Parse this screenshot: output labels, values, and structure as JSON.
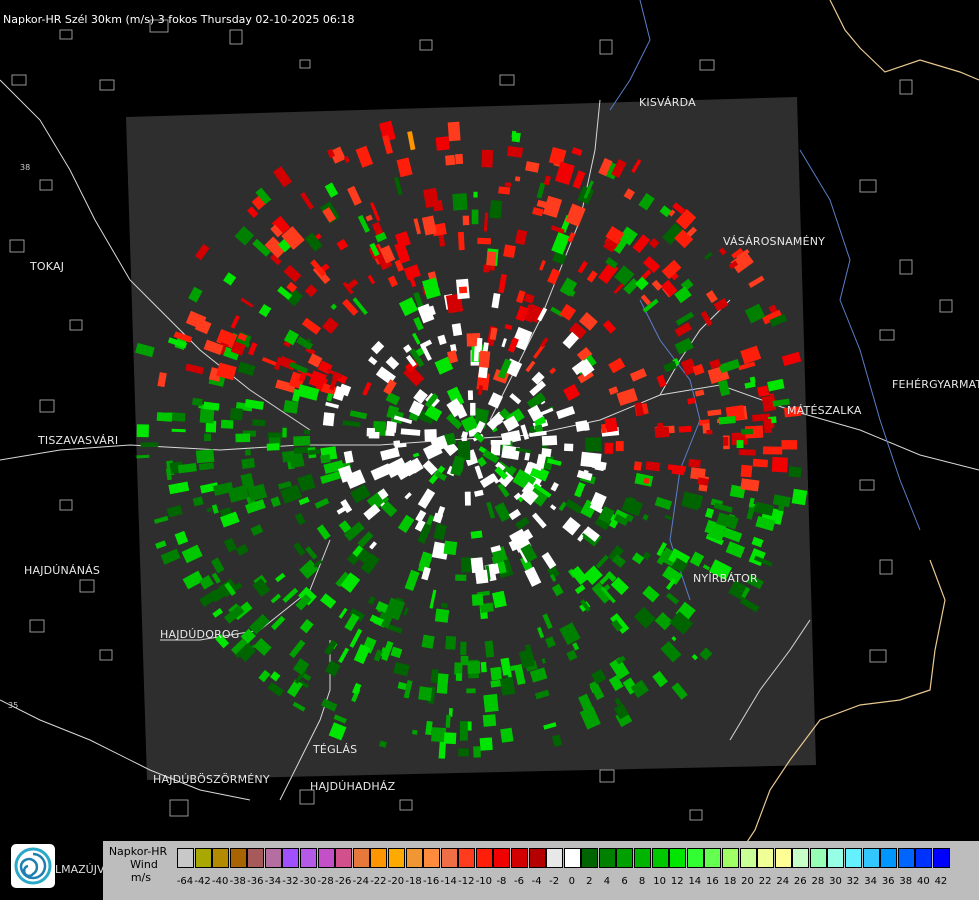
{
  "title": "Napkor-HR Szél 30km (m/s) 3 fokos Thursday 02-10-2025 06:18",
  "cities": [
    {
      "name": "KISVÁRDA"
    },
    {
      "name": "TOKAJ"
    },
    {
      "name": "VÁSÁROSNAMÉNY"
    },
    {
      "name": "FEHÉRGYARMAT"
    },
    {
      "name": "MÁTÉSZALKA"
    },
    {
      "name": "TISZAVASVÁRI"
    },
    {
      "name": "HAJDÚNÁNÁS"
    },
    {
      "name": "NYÍRBÁTOR"
    },
    {
      "name": "HAJDÚDOROG"
    },
    {
      "name": "TÉGLÁS"
    },
    {
      "name": "HAJDÚBÖSZÖRMÉNY"
    },
    {
      "name": "HAJDÚHADHÁZ"
    }
  ],
  "road_numbers": [
    "38",
    "35"
  ],
  "logo": {
    "partial_text": "LMAZÚJVÁR",
    "icon": "swirl-logo-icon"
  },
  "legend": {
    "line1": "Napkor-HR",
    "line2": "Wind",
    "line3": "m/s",
    "tick_labels": [
      "-64",
      "-42",
      "-40",
      "-38",
      "-36",
      "-34",
      "-32",
      "-30",
      "-28",
      "-26",
      "-24",
      "-22",
      "-20",
      "-18",
      "-16",
      "-14",
      "-12",
      "-10",
      "-8",
      "-6",
      "-4",
      "-2",
      "0",
      "2",
      "4",
      "6",
      "8",
      "10",
      "12",
      "14",
      "16",
      "18",
      "20",
      "22",
      "24",
      "26",
      "28",
      "30",
      "32",
      "34",
      "36",
      "38",
      "40",
      "42"
    ],
    "colors": [
      "#c8c8c8",
      "#a8a800",
      "#b48a00",
      "#a86400",
      "#a65a5a",
      "#b46ea0",
      "#a050ff",
      "#b45ae6",
      "#c450c8",
      "#d2508c",
      "#e6783c",
      "#ff9600",
      "#ffaa00",
      "#f09632",
      "#ff8c3c",
      "#f06e46",
      "#ff3c1e",
      "#ff1e0a",
      "#f00000",
      "#d20000",
      "#b40000",
      "#e8e8e8",
      "#ffffff",
      "#006400",
      "#008000",
      "#00a000",
      "#00b400",
      "#00c800",
      "#00e600",
      "#32ff32",
      "#64ff50",
      "#a0ff64",
      "#c8ff96",
      "#f0ff96",
      "#ffff96",
      "#c8ffc8",
      "#96ffb4",
      "#96ffe6",
      "#64f0ff",
      "#32c8ff",
      "#0096ff",
      "#0064ff",
      "#0032ff",
      "#0000ff"
    ],
    "highlight_color": "#ffffff"
  }
}
